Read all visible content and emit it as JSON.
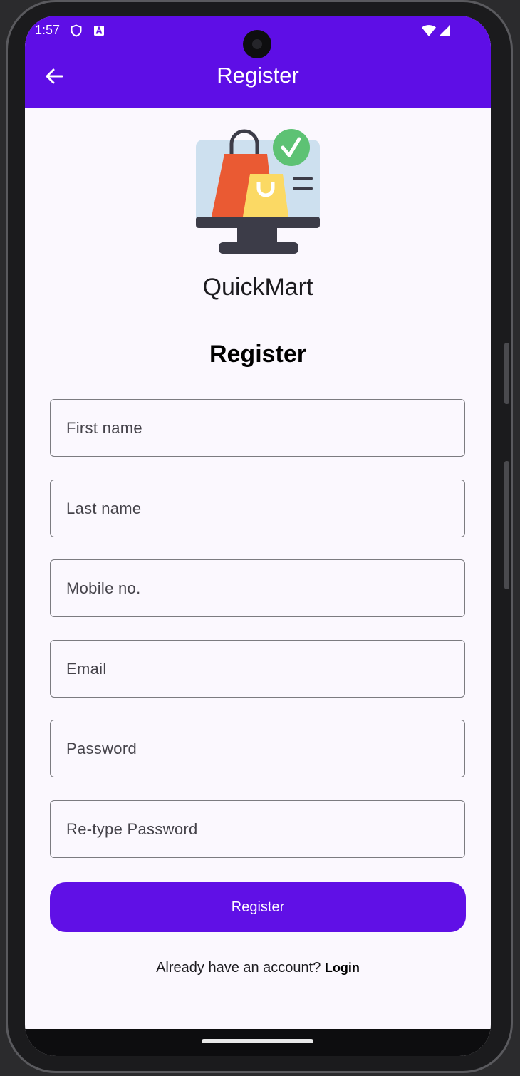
{
  "status_bar": {
    "time": "1:57"
  },
  "app_bar": {
    "title": "Register"
  },
  "brand": {
    "name": "QuickMart"
  },
  "form": {
    "heading": "Register",
    "fields": [
      {
        "placeholder": "First name",
        "value": ""
      },
      {
        "placeholder": "Last name",
        "value": ""
      },
      {
        "placeholder": "Mobile no.",
        "value": ""
      },
      {
        "placeholder": "Email",
        "value": ""
      },
      {
        "placeholder": "Password",
        "value": ""
      },
      {
        "placeholder": "Re-type Password",
        "value": ""
      }
    ],
    "submit_label": "Register"
  },
  "footer": {
    "prompt": "Already have an account?",
    "link_label": "Login"
  },
  "colors": {
    "primary": "#5e0ee6",
    "background": "#fbf8fe",
    "field_border": "#7b7b80"
  },
  "icons": {
    "back": "arrow-left-icon",
    "logo": "shopping-monitor-logo",
    "status_shield": "shield-icon",
    "status_notification": "a-badge-icon",
    "wifi": "wifi-icon",
    "signal": "signal-icon"
  }
}
